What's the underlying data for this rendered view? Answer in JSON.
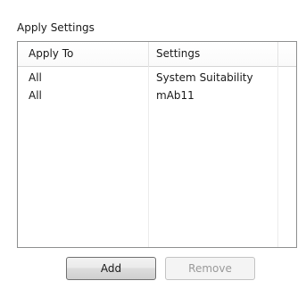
{
  "group": {
    "title": "Apply Settings"
  },
  "table": {
    "columns": [
      "Apply To",
      "Settings"
    ],
    "rows": [
      {
        "apply_to": "All",
        "settings": "System Suitability"
      },
      {
        "apply_to": "All",
        "settings": "mAb11"
      }
    ]
  },
  "buttons": {
    "add_label": "Add",
    "remove_label": "Remove",
    "remove_enabled": false
  }
}
